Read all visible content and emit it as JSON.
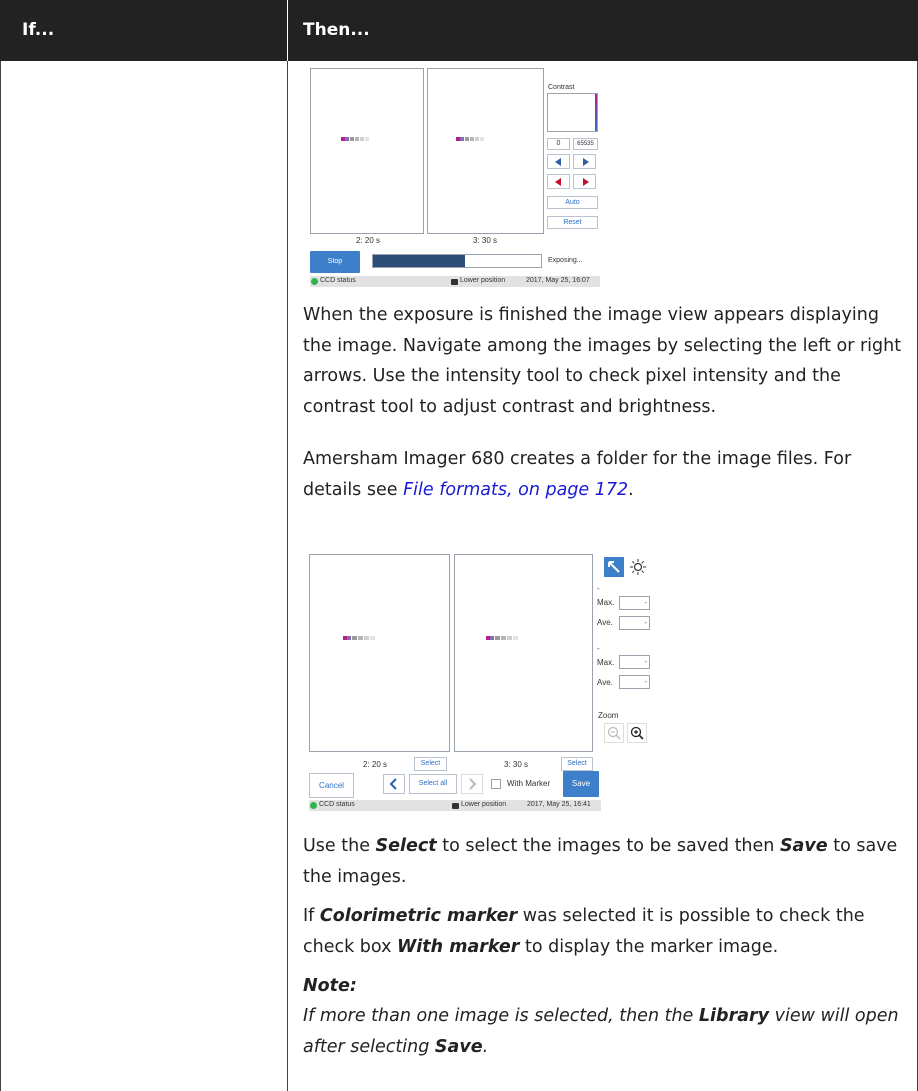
{
  "table": {
    "header_if": "If...",
    "header_then": "Then..."
  },
  "screenshot1": {
    "contrast_label": "Contrast",
    "min_value": "0",
    "max_value": "65535",
    "auto_label": "Auto",
    "reset_label": "Reset",
    "caption_a": "2: 20 s",
    "caption_b": "3: 30 s",
    "stop_label": "Stop",
    "exposing_label": "Exposing...",
    "exposure_progress": 0.55,
    "ccd_status": "CCD status",
    "position": "Lower position",
    "datetime": "2017, May 25, 16:07"
  },
  "para1": "When the exposure is finished the image view appears dis­playing the image. Navigate among the images by selecting the left or right arrows. Use the intensity tool to check pixel intensity and the contrast tool to adjust contrast and brightness.",
  "para2": {
    "text": "Amersham Imager 680 creates a folder for the image files. For details see ",
    "link": "File formats, on page 172",
    "end": "."
  },
  "screenshot2": {
    "max_label_1": "Max.",
    "ave_label_1": "Ave.",
    "max_label_2": "Max.",
    "ave_label_2": "Ave.",
    "dash": "-",
    "zoom_label": "Zoom",
    "caption_a": "2: 20 s",
    "caption_b": "3: 30 s",
    "select_label": "Select",
    "cancel_label": "Cancel",
    "select_all_label": "Select all",
    "with_marker_label": "With Marker",
    "save_label": "Save",
    "ccd_status": "CCD status",
    "position": "Lower position",
    "datetime": "2017, May 25, 16:41"
  },
  "para3": {
    "t1": "Use the ",
    "b1": "Select",
    "t2": " to select the images to be saved then ",
    "b2": "Save",
    "t3": " to save the images."
  },
  "para4": {
    "t1": "If ",
    "b1": "Colorimetric marker",
    "t2": " was selected it is possible to check the check box ",
    "b2": "With marker",
    "t3": " to display the marker image."
  },
  "note": {
    "title": "Note:",
    "t1": "If more than one image is selected, then the ",
    "b1": "Library",
    "t2": " view will open after selecting ",
    "b2": "Save",
    "t3": "."
  },
  "colors": {
    "header_bg": "#222222",
    "accent_blue": "#3d7fc9",
    "link_blue": "#1a1ad6",
    "marker_magenta": "#b0218e"
  }
}
